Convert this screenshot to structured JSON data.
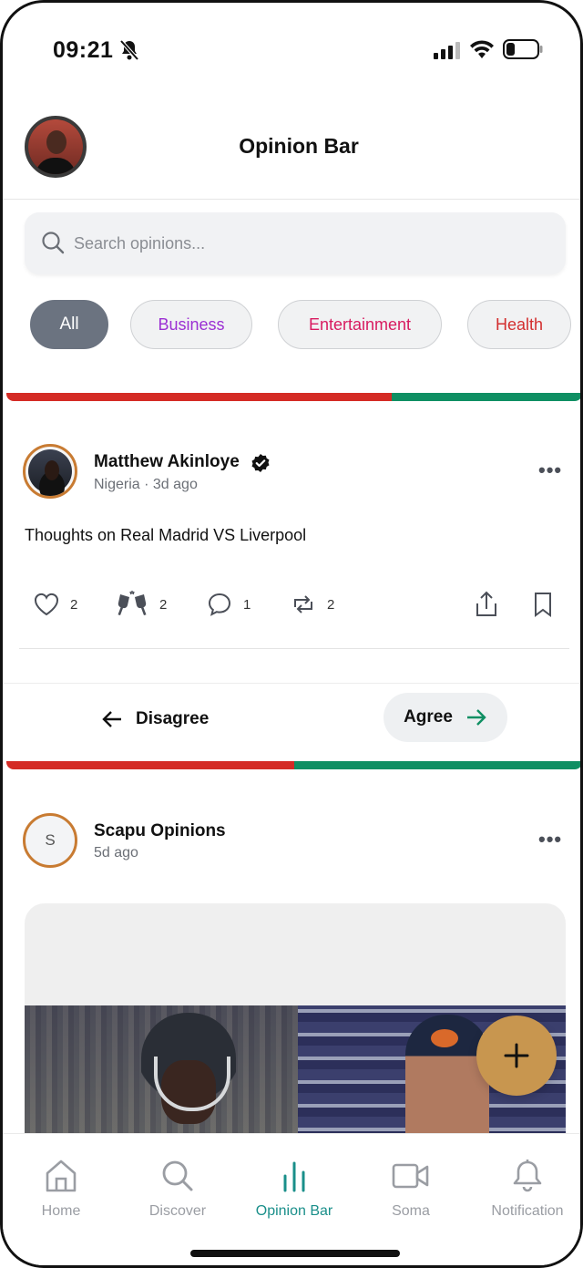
{
  "status_bar": {
    "time": "09:21",
    "icons": [
      "bell-slash-icon",
      "cellular-signal-icon",
      "wifi-icon",
      "battery-icon"
    ]
  },
  "header": {
    "title": "Opinion Bar",
    "avatar_icon": "user-avatar"
  },
  "search": {
    "placeholder": "Search opinions...",
    "value": ""
  },
  "categories": [
    {
      "label": "All",
      "active": true,
      "color": "#ffffff"
    },
    {
      "label": "Business",
      "active": false,
      "color": "#9b2fd3"
    },
    {
      "label": "Entertainment",
      "active": false,
      "color": "#d81b60"
    },
    {
      "label": "Health",
      "active": false,
      "color": "#d32f2f"
    }
  ],
  "posts": [
    {
      "author": "Matthew Akinloye",
      "verified": true,
      "location": "Nigeria",
      "time_ago": "3d ago",
      "meta": "Nigeria · 3d ago",
      "text": "Thoughts on Real Madrid VS Liverpool",
      "vote_bar": {
        "disagree_fraction": 0.67,
        "agree_fraction": 0.33
      },
      "actions": {
        "likes": "2",
        "cheers": "2",
        "comments": "1",
        "reposts": "2"
      },
      "vote_buttons": {
        "disagree_label": "Disagree",
        "agree_label": "Agree"
      }
    },
    {
      "author": "Scapu Opinions",
      "avatar_letter": "S",
      "time_ago": "5d ago",
      "vote_bar": {
        "disagree_fraction": 0.5,
        "agree_fraction": 0.5
      },
      "has_media": true
    }
  ],
  "fab": {
    "icon": "plus-icon"
  },
  "bottom_nav": [
    {
      "label": "Home",
      "icon": "home-icon",
      "active": false
    },
    {
      "label": "Discover",
      "icon": "search-icon",
      "active": false
    },
    {
      "label": "Opinion Bar",
      "icon": "bar-chart-icon",
      "active": true
    },
    {
      "label": "Soma",
      "icon": "video-camera-icon",
      "active": false
    },
    {
      "label": "Notification",
      "icon": "bell-icon",
      "active": false
    }
  ],
  "colors": {
    "disagree": "#d42b25",
    "agree": "#0f8f63",
    "nav_active": "#1a8f8a",
    "fab": "#c8964f",
    "avatar_ring": "#c87b32"
  }
}
